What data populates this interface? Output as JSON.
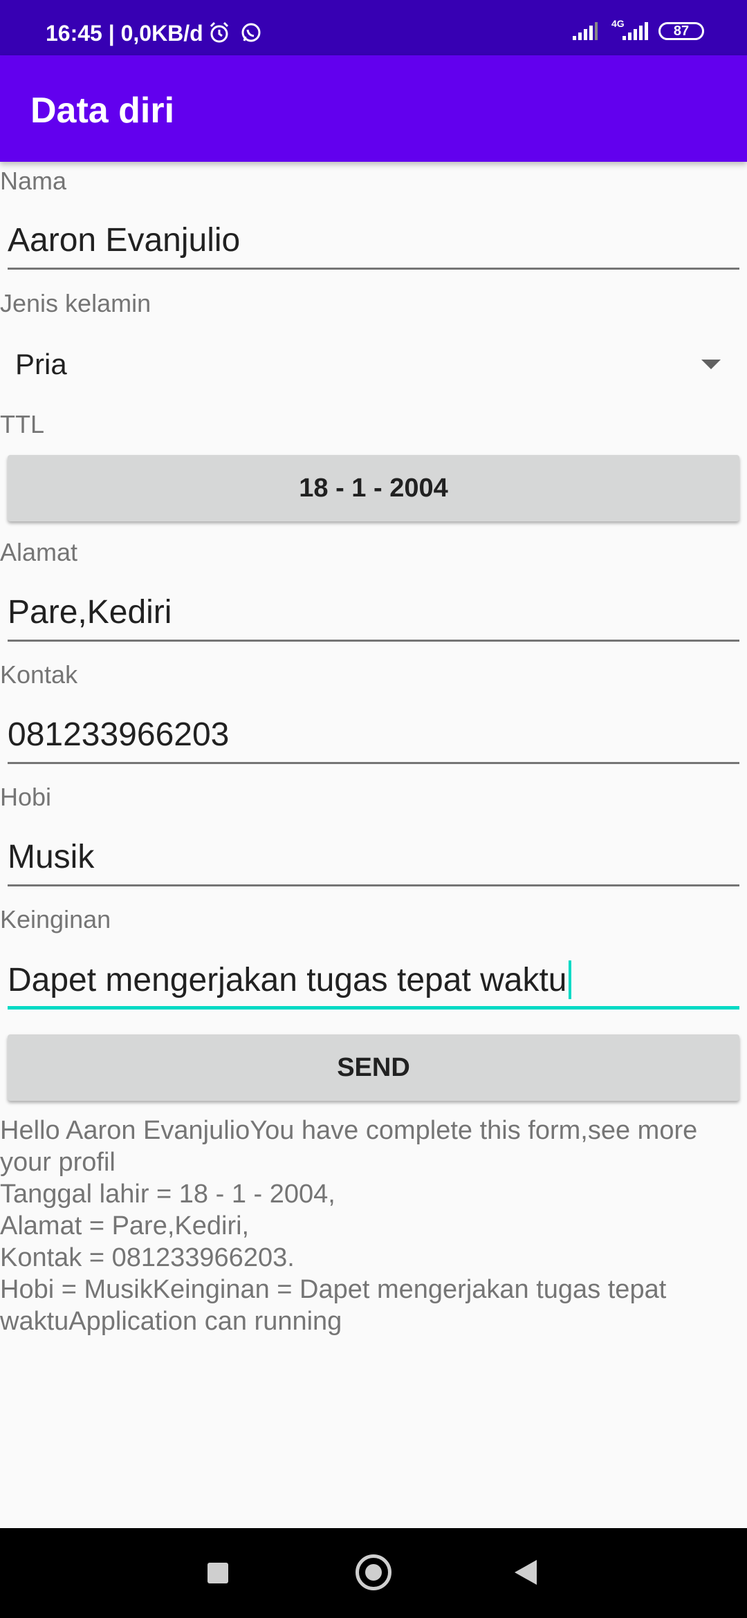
{
  "status_bar": {
    "time_text": "16:45 | 0,0KB/d",
    "network_label": "4G",
    "battery_level": "87",
    "icons": [
      "alarm-icon",
      "whatsapp-icon",
      "signal-icon",
      "signal-4g-icon",
      "battery-icon"
    ]
  },
  "app_bar": {
    "title": "Data diri"
  },
  "form": {
    "nama_label": "Nama",
    "nama_value": "Aaron Evanjulio",
    "jenis_kelamin_label": "Jenis kelamin",
    "jenis_kelamin_value": "Pria",
    "ttl_label": "TTL",
    "ttl_button": "18 - 1 - 2004",
    "alamat_label": "Alamat",
    "alamat_value": "Pare,Kediri",
    "kontak_label": "Kontak",
    "kontak_value": "081233966203",
    "hobi_label": "Hobi",
    "hobi_value": "Musik",
    "keinginan_label": "Keinginan",
    "keinginan_value": "Dapet mengerjakan tugas tepat waktu",
    "send_button": "SEND"
  },
  "result": {
    "line1": "Hello Aaron EvanjulioYou have complete this form,see more your profil",
    "line2": "Tanggal lahir = 18 - 1 - 2004,",
    "line3": "Alamat = Pare,Kediri,",
    "line4": "Kontak = 081233966203.",
    "line5": "Hobi = MusikKeinginan = Dapet mengerjakan tugas tepat waktuApplication can running"
  },
  "colors": {
    "status_bar": "#3700b3",
    "app_bar": "#6200ee",
    "accent": "#03dac5",
    "button": "#d6d7d7"
  }
}
